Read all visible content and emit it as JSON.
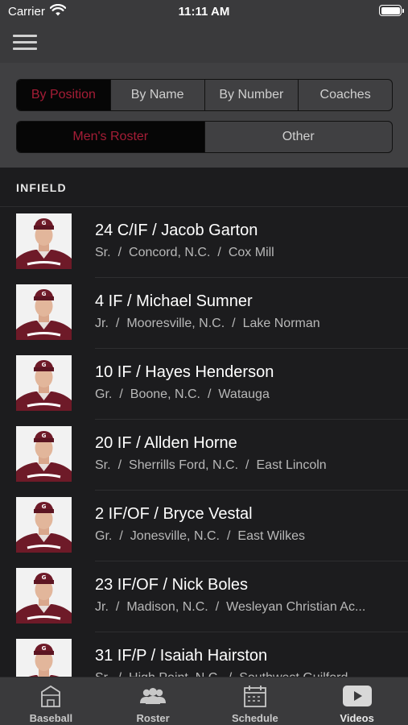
{
  "status_bar": {
    "carrier": "Carrier",
    "time": "11:11 AM"
  },
  "nav": {
    "menu_icon": "hamburger-menu-icon"
  },
  "filters": {
    "sort_tabs": [
      {
        "label": "By Position",
        "active": true
      },
      {
        "label": "By Name",
        "active": false
      },
      {
        "label": "By Number",
        "active": false
      },
      {
        "label": "Coaches",
        "active": false
      }
    ],
    "roster_tabs": [
      {
        "label": "Men's Roster",
        "active": true
      },
      {
        "label": "Other",
        "active": false
      }
    ],
    "accent_color": "#a51d36"
  },
  "roster": {
    "section_title": "INFIELD",
    "players": [
      {
        "title": "24 C/IF / Jacob Garton",
        "year": "Sr.",
        "hometown": "Concord, N.C.",
        "school": "Cox Mill"
      },
      {
        "title": "4 IF / Michael Sumner",
        "year": "Jr.",
        "hometown": "Mooresville, N.C.",
        "school": "Lake Norman"
      },
      {
        "title": "10 IF / Hayes Henderson",
        "year": "Gr.",
        "hometown": "Boone, N.C.",
        "school": "Watauga"
      },
      {
        "title": "20 IF / Allden Horne",
        "year": "Sr.",
        "hometown": "Sherrills Ford, N.C.",
        "school": "East Lincoln"
      },
      {
        "title": "2 IF/OF / Bryce Vestal",
        "year": "Gr.",
        "hometown": "Jonesville, N.C.",
        "school": "East Wilkes"
      },
      {
        "title": "23 IF/OF / Nick Boles",
        "year": "Jr.",
        "hometown": "Madison, N.C.",
        "school": "Wesleyan Christian Ac..."
      },
      {
        "title": "31 IF/P / Isaiah Hairston",
        "year": "Sr.",
        "hometown": "High Point, N.C.",
        "school": "Southwest Guilford"
      }
    ],
    "separator": "/"
  },
  "tab_bar": {
    "tabs": [
      {
        "label": "Baseball",
        "icon": "stadium-icon"
      },
      {
        "label": "Roster",
        "icon": "people-icon"
      },
      {
        "label": "Schedule",
        "icon": "calendar-icon"
      },
      {
        "label": "Videos",
        "icon": "video-play-icon"
      }
    ]
  }
}
